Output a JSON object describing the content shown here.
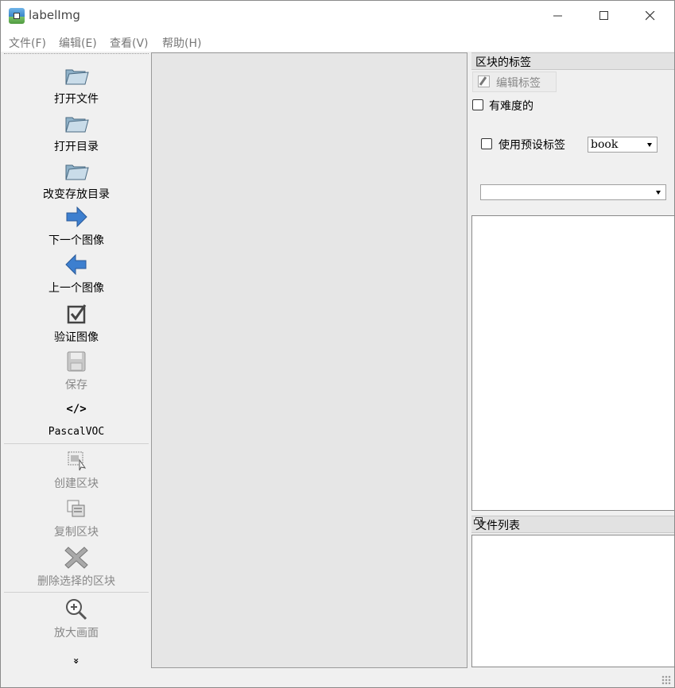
{
  "window": {
    "title": "labelImg"
  },
  "menu": [
    "文件(F)",
    "编辑(E)",
    "查看(V)",
    "帮助(H)"
  ],
  "toolbar": {
    "tools": [
      {
        "label": "打开文件",
        "icon": "folder-open-icon",
        "enabled": true
      },
      {
        "label": "打开目录",
        "icon": "folder-open-icon",
        "enabled": true
      },
      {
        "label": "改变存放目录",
        "icon": "folder-open-icon",
        "enabled": true
      },
      {
        "label": "下一个图像",
        "icon": "arrow-right-icon",
        "enabled": true
      },
      {
        "label": "上一个图像",
        "icon": "arrow-left-icon",
        "enabled": true
      },
      {
        "label": "验证图像",
        "icon": "checkbox-icon",
        "enabled": true
      },
      {
        "label": "保存",
        "icon": "save-icon",
        "enabled": false
      },
      {
        "label": "PascalVOC",
        "icon": "code-icon",
        "glyph": "</>",
        "enabled": true
      },
      {
        "label": "创建区块",
        "icon": "create-box-icon",
        "enabled": false
      },
      {
        "label": "复制区块",
        "icon": "copy-box-icon",
        "enabled": false
      },
      {
        "label": "删除选择的区块",
        "icon": "delete-cross-icon",
        "enabled": false
      },
      {
        "label": "放大画面",
        "icon": "zoom-in-icon",
        "enabled": false
      }
    ],
    "more": "»"
  },
  "box_labels": {
    "title": "区块的标签",
    "edit_label": "编辑标签",
    "difficult": "有难度的",
    "use_default": "使用预设标签",
    "default_label": "book"
  },
  "file_list": {
    "title": "文件列表"
  },
  "colors": {
    "accent_blue": "#3d7fcf",
    "canvas_bg": "#e6e6e6"
  }
}
